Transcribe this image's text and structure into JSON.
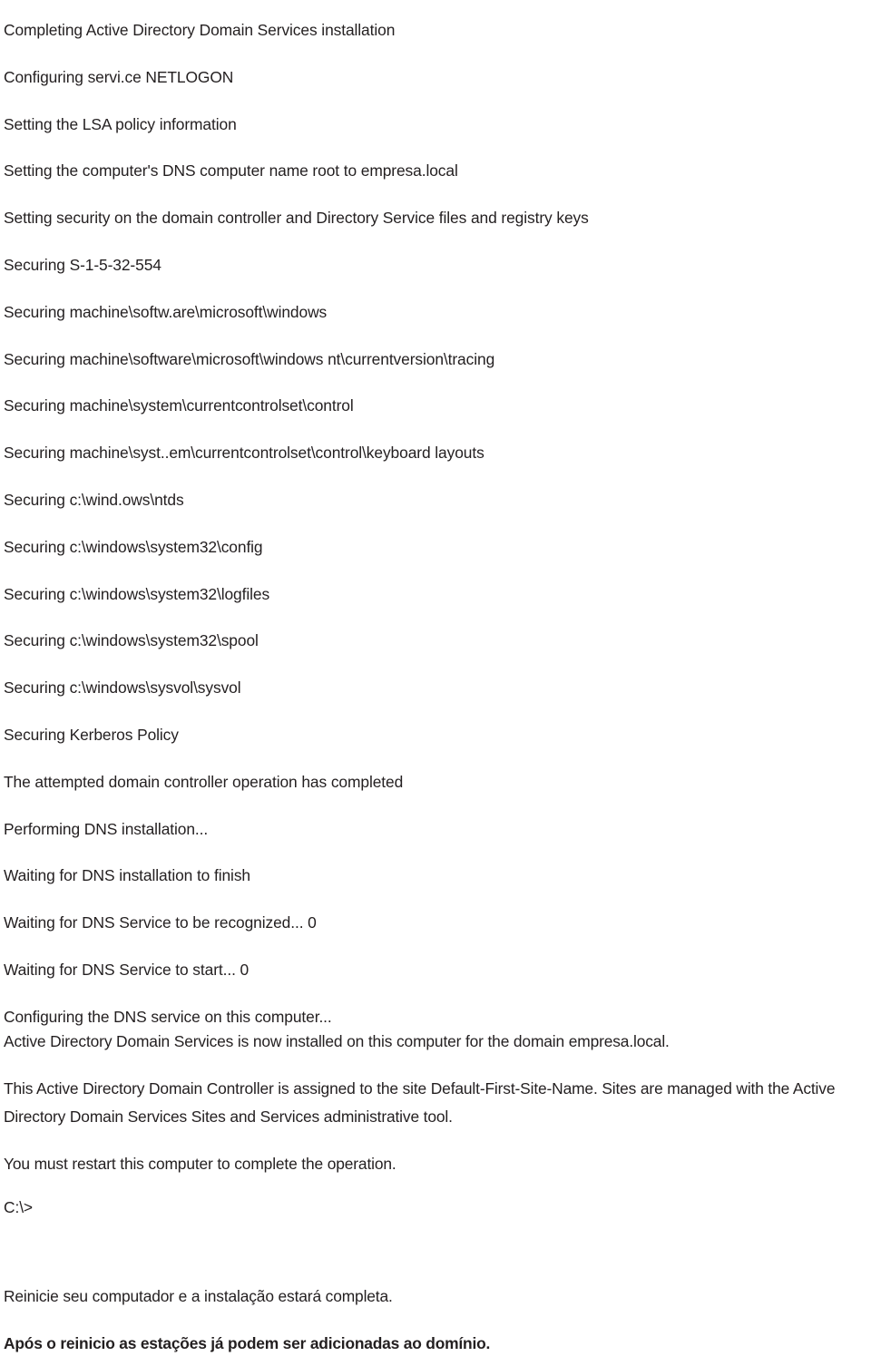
{
  "document": {
    "kind": "console-output-transcript",
    "background_color": "#ffffff",
    "text_color": "#231f20",
    "log_lines": [
      "Completing Active Directory Domain Services installation",
      "Configuring servi.ce NETLOGON",
      "Setting the LSA policy information",
      "Setting the computer's DNS computer name root to empresa.local",
      "Setting security on the domain controller and Directory Service files and registry keys",
      "Securing S-1-5-32-554",
      "Securing machine\\softw.are\\microsoft\\windows",
      "Securing machine\\software\\microsoft\\windows nt\\currentversion\\tracing",
      "Securing machine\\system\\currentcontrolset\\control",
      "Securing machine\\syst..em\\currentcontrolset\\control\\keyboard layouts",
      "Securing c:\\wind.ows\\ntds",
      "Securing c:\\windows\\system32\\config",
      "Securing c:\\windows\\system32\\logfiles",
      "Securing c:\\windows\\system32\\spool",
      "Securing c:\\windows\\sysvol\\sysvol",
      "Securing Kerberos Policy",
      "The attempted domain controller operation has completed",
      "Performing DNS installation...",
      "Waiting for DNS installation to finish",
      "Waiting for DNS Service to be recognized... 0",
      "Waiting for DNS Service to start... 0",
      "Configuring the DNS service on this computer..."
    ],
    "paragraphs": [
      "Active Directory Domain Services is now installed on this computer for the domain empresa.local.",
      "This Active Directory Domain Controller is assigned to the site Default-First-Site-Name. Sites are managed with the Active Directory Domain Services Sites and Services administrative tool.",
      "You must restart this computer to complete the operation."
    ],
    "prompt": "C:\\>",
    "footer_lines": [
      "Reinicie seu computador e a instalação estará completa.",
      "Após o reinicio as estações já podem ser adicionadas ao domínio."
    ]
  }
}
